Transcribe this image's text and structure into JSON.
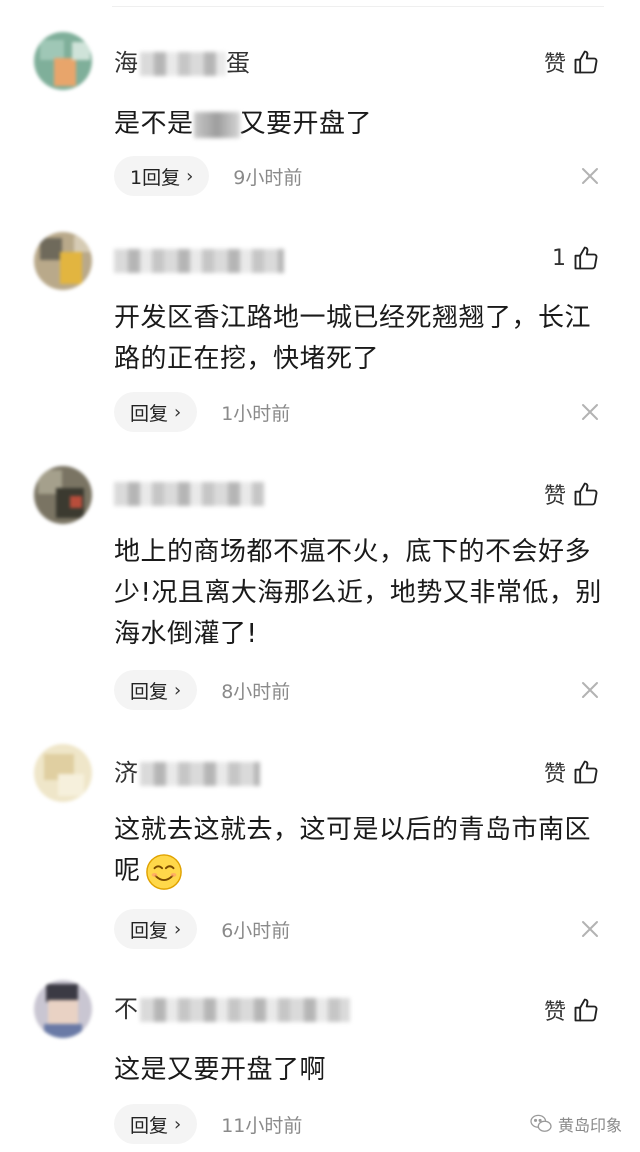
{
  "comments": [
    {
      "username_visible": "海",
      "username_tail": "蛋",
      "like_label": "赞",
      "content_before": "是不是",
      "content_after": "又要开盘了",
      "reply_label": "1回复",
      "time": "9小时前"
    },
    {
      "username_visible": "",
      "like_label": "1",
      "content": "开发区香江路地一城已经死翘翘了，长江路的正在挖，快堵死了",
      "reply_label": "回复",
      "time": "1小时前"
    },
    {
      "username_visible": "",
      "like_label": "赞",
      "content": "地上的商场都不瘟不火，底下的不会好多少!况且离大海那么近，地势又非常低，别海水倒灌了!",
      "reply_label": "回复",
      "time": "8小时前"
    },
    {
      "username_visible": "济",
      "like_label": "赞",
      "content": "这就去这就去，这可是以后的青岛市南区呢",
      "reply_label": "回复",
      "time": "6小时前"
    },
    {
      "username_visible": "不",
      "like_label": "赞",
      "content": "这是又要开盘了啊",
      "reply_label": "回复",
      "time": "11小时前"
    }
  ],
  "watermark": {
    "text": "黄岛印象",
    "icon": "wechat-icon"
  },
  "icons": {
    "like": "thumbs-up-icon",
    "close": "close-icon",
    "reply_chevron": "chevron-right-icon",
    "emoji": "smiling-face-emoji"
  }
}
